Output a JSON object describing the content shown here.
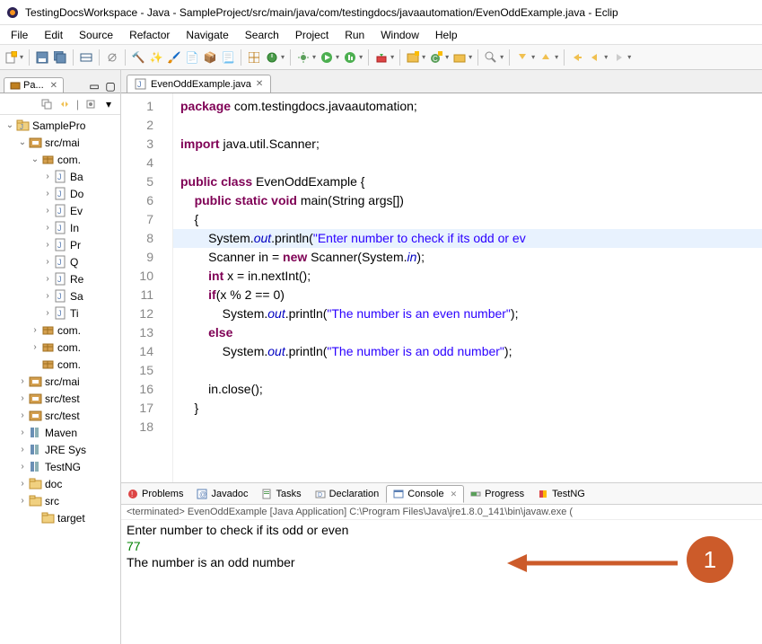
{
  "window": {
    "title": "TestingDocsWorkspace - Java - SampleProject/src/main/java/com/testingdocs/javaautomation/EvenOddExample.java - Eclip"
  },
  "menu": [
    "File",
    "Edit",
    "Source",
    "Refactor",
    "Navigate",
    "Search",
    "Project",
    "Run",
    "Window",
    "Help"
  ],
  "sidebar": {
    "view_title": "Pa...",
    "tree": [
      {
        "d": 0,
        "tw": "v",
        "icon": "project",
        "label": "SamplePro"
      },
      {
        "d": 1,
        "tw": "v",
        "icon": "src",
        "label": "src/mai"
      },
      {
        "d": 2,
        "tw": "v",
        "icon": "pkg",
        "label": "com."
      },
      {
        "d": 3,
        "tw": ">",
        "icon": "cu",
        "label": "Ba"
      },
      {
        "d": 3,
        "tw": ">",
        "icon": "cu",
        "label": "Do"
      },
      {
        "d": 3,
        "tw": ">",
        "icon": "cu",
        "label": "Ev"
      },
      {
        "d": 3,
        "tw": ">",
        "icon": "cu",
        "label": "In"
      },
      {
        "d": 3,
        "tw": ">",
        "icon": "cu",
        "label": "Pr"
      },
      {
        "d": 3,
        "tw": ">",
        "icon": "cu",
        "label": "Q"
      },
      {
        "d": 3,
        "tw": ">",
        "icon": "cu",
        "label": "Re"
      },
      {
        "d": 3,
        "tw": ">",
        "icon": "cu",
        "label": "Sa"
      },
      {
        "d": 3,
        "tw": ">",
        "icon": "cu",
        "label": "Ti"
      },
      {
        "d": 2,
        "tw": ">",
        "icon": "pkg",
        "label": "com."
      },
      {
        "d": 2,
        "tw": ">",
        "icon": "pkg",
        "label": "com."
      },
      {
        "d": 2,
        "tw": "",
        "icon": "pkg",
        "label": "com."
      },
      {
        "d": 1,
        "tw": ">",
        "icon": "src",
        "label": "src/mai"
      },
      {
        "d": 1,
        "tw": ">",
        "icon": "src",
        "label": "src/test"
      },
      {
        "d": 1,
        "tw": ">",
        "icon": "src",
        "label": "src/test"
      },
      {
        "d": 1,
        "tw": ">",
        "icon": "lib",
        "label": "Maven"
      },
      {
        "d": 1,
        "tw": ">",
        "icon": "lib",
        "label": "JRE Sys"
      },
      {
        "d": 1,
        "tw": ">",
        "icon": "lib",
        "label": "TestNG"
      },
      {
        "d": 1,
        "tw": ">",
        "icon": "folder",
        "label": "doc"
      },
      {
        "d": 1,
        "tw": ">",
        "icon": "folder",
        "label": "src"
      },
      {
        "d": 2,
        "tw": "",
        "icon": "folder",
        "label": "target"
      }
    ]
  },
  "editor": {
    "tab_name": "EvenOddExample.java",
    "lines": [
      {
        "n": 1,
        "html": "<span class='kw'>package</span> com.testingdocs.javaautomation;"
      },
      {
        "n": 2,
        "html": ""
      },
      {
        "n": 3,
        "html": "<span class='kw'>import</span> java.util.Scanner;"
      },
      {
        "n": 4,
        "html": ""
      },
      {
        "n": 5,
        "html": "<span class='kw'>public</span> <span class='kw'>class</span> EvenOddExample {"
      },
      {
        "n": 6,
        "html": "    <span class='kw'>public</span> <span class='kw'>static</span> <span class='kw'>void</span> main(String args[])"
      },
      {
        "n": 7,
        "html": "    {"
      },
      {
        "n": 8,
        "html": "        System.<span class='fld'>out</span>.println(<span class='str'>\"Enter number to check if its odd or ev</span>",
        "hl": true
      },
      {
        "n": 9,
        "html": "        Scanner in = <span class='kw'>new</span> Scanner(System.<span class='fld'>in</span>);"
      },
      {
        "n": 10,
        "html": "        <span class='kw'>int</span> x = in.nextInt();"
      },
      {
        "n": 11,
        "html": "        <span class='kw'>if</span>(x % 2 == 0)"
      },
      {
        "n": 12,
        "html": "            System.<span class='fld'>out</span>.println(<span class='str'>\"The number is an even number\"</span>);"
      },
      {
        "n": 13,
        "html": "        <span class='kw'>else</span>"
      },
      {
        "n": 14,
        "html": "            System.<span class='fld'>out</span>.println(<span class='str'>\"The number is an odd number\"</span>);"
      },
      {
        "n": 15,
        "html": ""
      },
      {
        "n": 16,
        "html": "        in.close();"
      },
      {
        "n": 17,
        "html": "    }"
      },
      {
        "n": 18,
        "html": ""
      }
    ]
  },
  "bottom": {
    "tabs": [
      "Problems",
      "Javadoc",
      "Tasks",
      "Declaration",
      "Console",
      "Progress",
      "TestNG"
    ],
    "active": 4,
    "console_header": "<terminated> EvenOddExample [Java Application] C:\\Program Files\\Java\\jre1.8.0_141\\bin\\javaw.exe (",
    "console_lines": [
      {
        "text": "Enter number to check if its odd or even",
        "cls": ""
      },
      {
        "text": "77",
        "cls": "in"
      },
      {
        "text": "The number is an odd number",
        "cls": ""
      }
    ]
  },
  "annotation": {
    "number": "1"
  }
}
